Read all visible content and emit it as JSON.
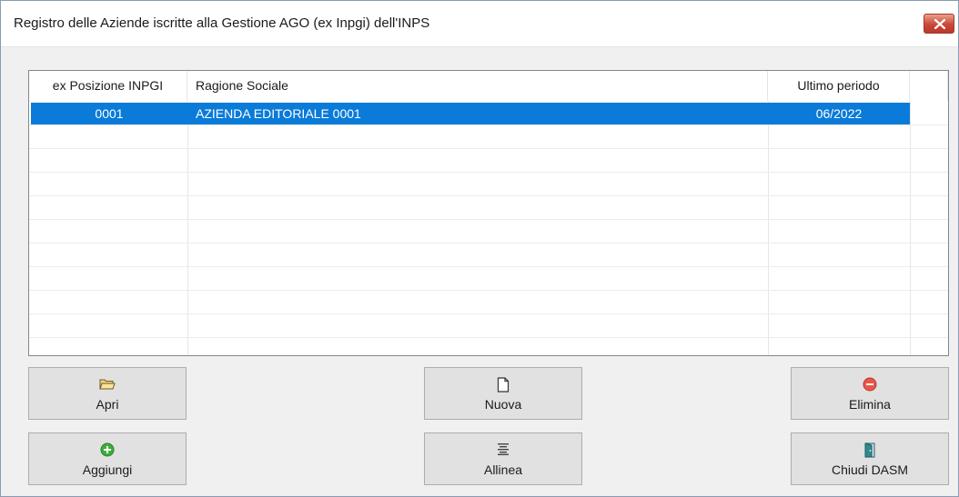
{
  "window": {
    "title": "Registro delle Aziende iscritte alla Gestione AGO (ex Inpgi) dell'INPS"
  },
  "table": {
    "columns": [
      "ex Posizione INPGI",
      "Ragione Sociale",
      "Ultimo periodo"
    ],
    "rows": [
      {
        "posizione": "0001",
        "ragione_sociale": "AZIENDA EDITORIALE 0001",
        "ultimo_periodo": "06/2022"
      }
    ]
  },
  "buttons": {
    "apri": "Apri",
    "nuova": "Nuova",
    "elimina": "Elimina",
    "aggiungi": "Aggiungi",
    "allinea": "Allinea",
    "chiudi": "Chiudi DASM"
  },
  "colors": {
    "selection": "#0a7bd8",
    "close_button": "#c9483a"
  },
  "icons": {
    "apri": "folder-open-icon",
    "nuova": "new-document-icon",
    "elimina": "minus-circle-icon",
    "aggiungi": "plus-circle-icon",
    "allinea": "align-lines-icon",
    "chiudi": "exit-door-icon",
    "close": "close-icon"
  }
}
